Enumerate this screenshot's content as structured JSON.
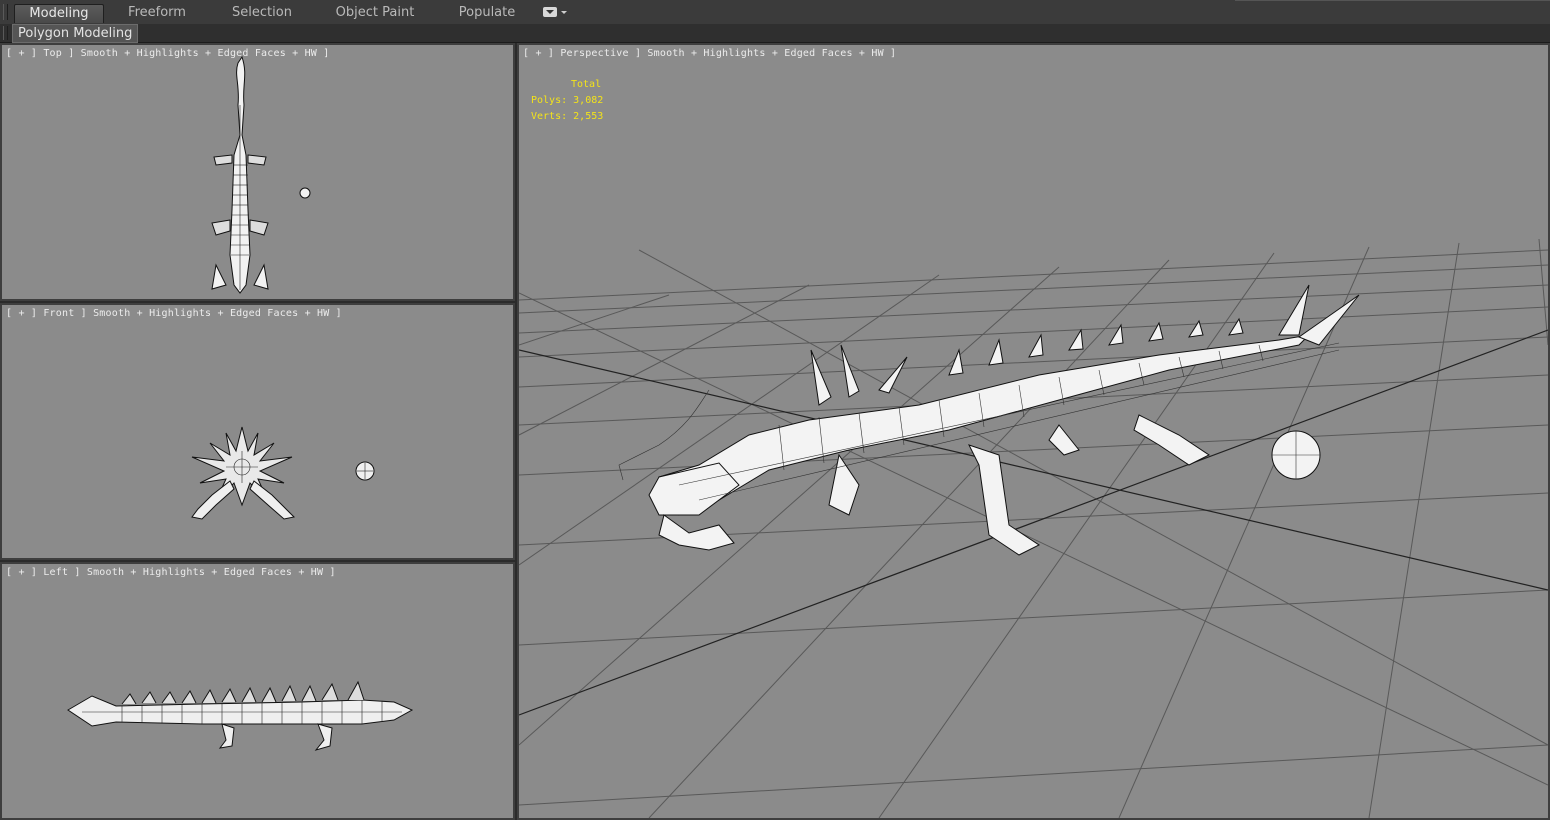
{
  "ribbon": {
    "tabs": [
      {
        "label": "Modeling",
        "active": true
      },
      {
        "label": "Freeform",
        "active": false
      },
      {
        "label": "Selection",
        "active": false
      },
      {
        "label": "Object Paint",
        "active": false
      },
      {
        "label": "Populate",
        "active": false
      }
    ],
    "options_icon": "ribbon-options-dropdown-icon"
  },
  "panel": {
    "label": "Polygon Modeling"
  },
  "viewports": {
    "top": {
      "label": "[ + ] Top ] Smooth + Highlights + Edged Faces + HW ]"
    },
    "front": {
      "label": "[ + ] Front ] Smooth + Highlights + Edged Faces + HW ]"
    },
    "left": {
      "label": "[ + ] Left ] Smooth + Highlights + Edged Faces + HW ]"
    },
    "perspective": {
      "label": "[ + ] Perspective ] Smooth + Highlights + Edged Faces + HW ]"
    }
  },
  "stats": {
    "header": "Total",
    "polys_label": "Polys:",
    "polys_value": "3,082",
    "verts_label": "Verts:",
    "verts_value": "2,553"
  },
  "colors": {
    "viewport_bg": "#8b8b8b",
    "stats_text": "#f3e31a",
    "active_tab": "#4f4f4f",
    "ui_dark": "#2b2b2b"
  }
}
